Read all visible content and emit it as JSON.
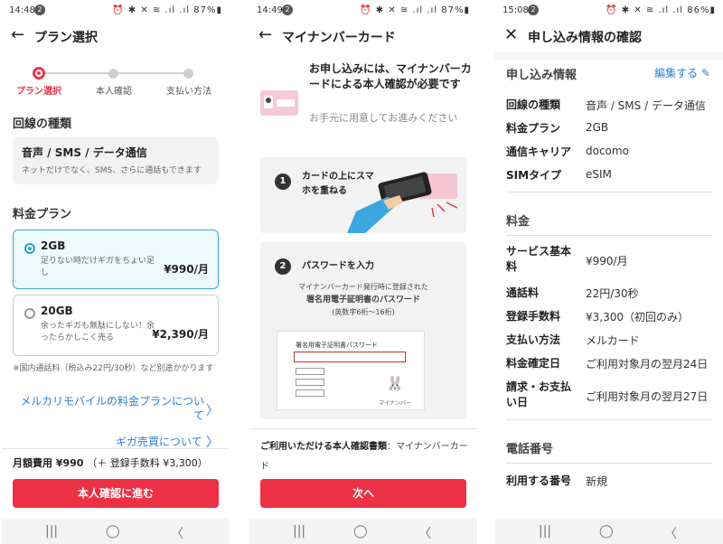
{
  "screen1": {
    "status": {
      "time": "14:48",
      "badge": "2",
      "right": "⏰ ✱ ✕ ≋ .ıl .ıl 87%▮"
    },
    "title": "プラン選択",
    "steps": [
      "プラン選択",
      "本人確認",
      "支払い方法"
    ],
    "line_section": "回線の種類",
    "line_type": {
      "title": "音声 / SMS / データ通信",
      "sub": "ネットだけでなく、SMS、さらに通話もできます"
    },
    "plan_section": "料金プラン",
    "plans": [
      {
        "name": "2GB",
        "desc": "足りない時だけギガをちょい足し",
        "price": "¥990/月",
        "selected": true
      },
      {
        "name": "20GB",
        "desc": "余ったギガも無駄にしない！余ったらかしこく売る",
        "price": "¥2,390/月",
        "selected": false
      }
    ],
    "note": "※国内通話料（税込み22円/30秒）など別途かかります",
    "link1": "メルカリモバイルの料金プランについて",
    "link2": "ギガ売買について",
    "total_label": "月額費用 ¥990",
    "total_extra": "（＋ 登録手数料 ¥3,300）",
    "cta": "本人確認に進む"
  },
  "screen2": {
    "status": {
      "time": "14:49",
      "badge": "2",
      "right": "⏰ ✱ ✕ ≋ .ıl .ıl 87%▮"
    },
    "title": "マイナンバーカード",
    "lead": "お申し込みには、マイナンバーカードによる本人確認が必要です",
    "sub": "お手元に用意してお進みください",
    "step1": {
      "num": "1",
      "text": "カードの上にスマホを重ねる"
    },
    "step2": {
      "num": "2",
      "text": "パスワードを入力",
      "desc1": "マイナンバーカード発行時に登録された",
      "desc2": "署名用電子証明書のパスワード",
      "desc3": "(英数字6桁〜16桁)",
      "panel_label": "署名用電子証明書パスワード",
      "mascot_label": "マイナンバー"
    },
    "footer_label": "ご利用いただける本人確認書類",
    "footer_value": "：マイナンバーカード",
    "cta": "次へ"
  },
  "screen3": {
    "status": {
      "time": "15:08",
      "badge": "2",
      "right": "⏰ ✱ ✕ ≋ .ıl .ıl 86%▮"
    },
    "title": "申し込み情報の確認",
    "section1": "申し込み情報",
    "edit": "編集する",
    "info": [
      {
        "k": "回線の種類",
        "v": "音声 / SMS / データ通信"
      },
      {
        "k": "料金プラン",
        "v": "2GB"
      },
      {
        "k": "通信キャリア",
        "v": "docomo"
      },
      {
        "k": "SIMタイプ",
        "v": "eSIM"
      }
    ],
    "section2": "料金",
    "fees": [
      {
        "k": "サービス基本料",
        "v": "¥990/月"
      },
      {
        "k": "通話料",
        "v": "22円/30秒"
      },
      {
        "k": "登録手数料",
        "v": "¥3,300（初回のみ）"
      },
      {
        "k": "支払い方法",
        "v": "メルカード"
      },
      {
        "k": "料金確定日",
        "v": "ご利用対象月の翌月24日"
      },
      {
        "k": "請求・お支払い日",
        "v": "ご利用対象月の翌月27日"
      }
    ],
    "section3": "電話番号",
    "phone": {
      "k": "利用する番号",
      "v": "新規"
    }
  },
  "nav": {
    "recent": "|||",
    "home": "◯",
    "back": "〈"
  }
}
